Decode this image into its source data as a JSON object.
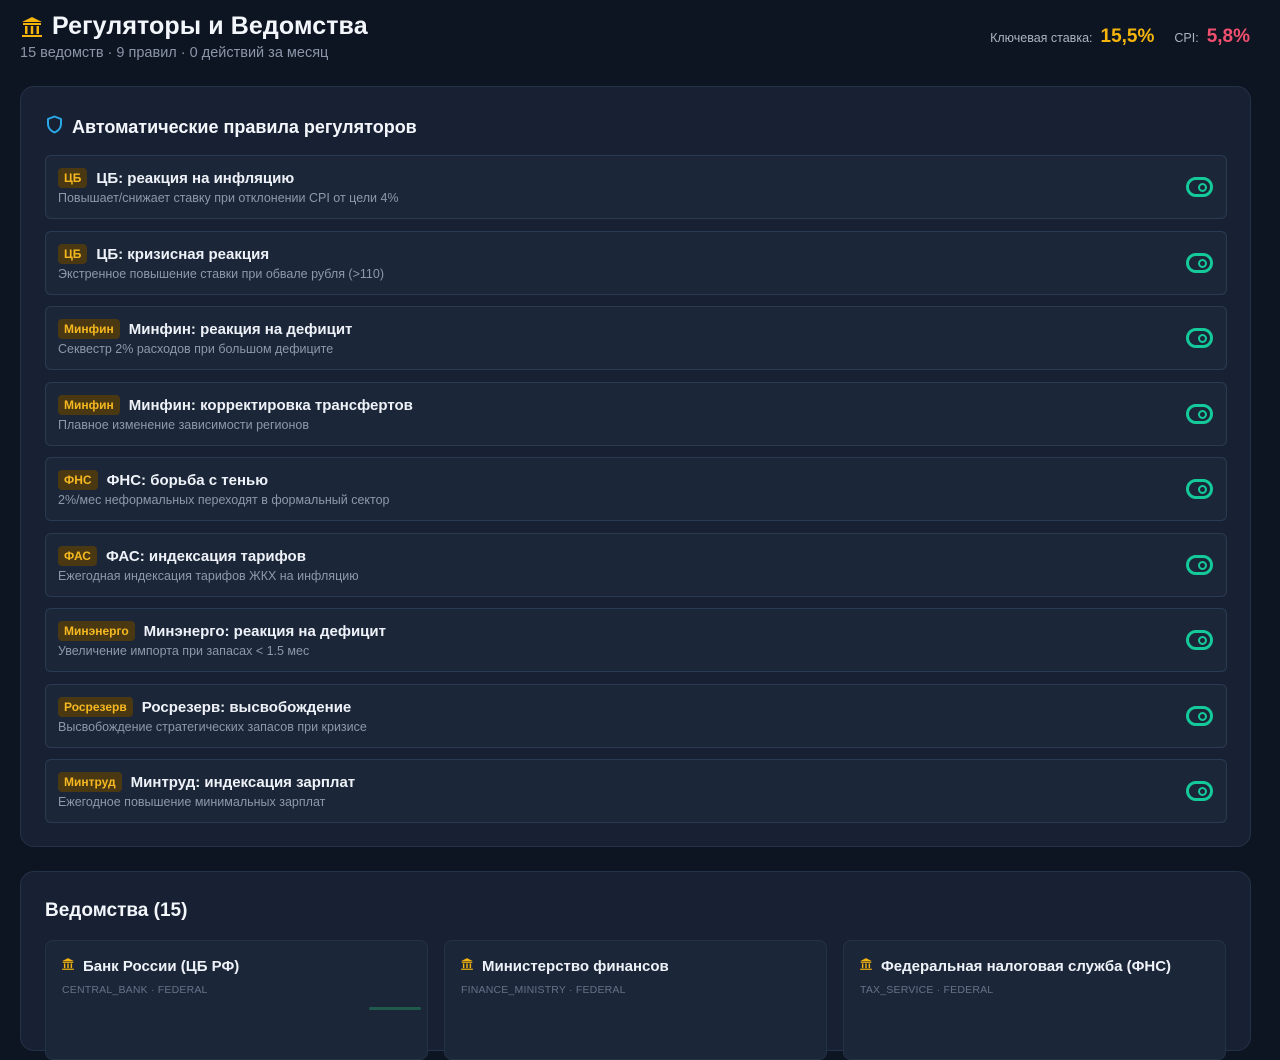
{
  "header": {
    "title": "Регуляторы и Ведомства",
    "subtitle": "15 ведомств · 9 правил · 0 действий за месяц",
    "key_rate_label": "Ключевая ставка:",
    "key_rate_value": "15,5%",
    "cpi_label": "CPI:",
    "cpi_value": "5,8%"
  },
  "rules_panel": {
    "title": "Автоматические правила регуляторов",
    "rules": [
      {
        "badge": "ЦБ",
        "name": "ЦБ: реакция на инфляцию",
        "desc": "Повышает/снижает ставку при отклонении CPI от цели 4%",
        "enabled": true
      },
      {
        "badge": "ЦБ",
        "name": "ЦБ: кризисная реакция",
        "desc": "Экстренное повышение ставки при обвале рубля (>110)",
        "enabled": true
      },
      {
        "badge": "Минфин",
        "name": "Минфин: реакция на дефицит",
        "desc": "Секвестр 2% расходов при большом дефиците",
        "enabled": true
      },
      {
        "badge": "Минфин",
        "name": "Минфин: корректировка трансфертов",
        "desc": "Плавное изменение зависимости регионов",
        "enabled": true
      },
      {
        "badge": "ФНС",
        "name": "ФНС: борьба с тенью",
        "desc": "2%/мес неформальных переходят в формальный сектор",
        "enabled": true
      },
      {
        "badge": "ФАС",
        "name": "ФАС: индексация тарифов",
        "desc": "Ежегодная индексация тарифов ЖКХ на инфляцию",
        "enabled": true
      },
      {
        "badge": "Минэнерго",
        "name": "Минэнерго: реакция на дефицит",
        "desc": "Увеличение импорта при запасах < 1.5 мес",
        "enabled": true
      },
      {
        "badge": "Росрезерв",
        "name": "Росрезерв: высвобождение",
        "desc": "Высвобождение стратегических запасов при кризисе",
        "enabled": true
      },
      {
        "badge": "Минтруд",
        "name": "Минтруд: индексация зарплат",
        "desc": "Ежегодное повышение минимальных зарплат",
        "enabled": true
      }
    ]
  },
  "agencies_panel": {
    "title": "Ведомства (15)",
    "agencies": [
      {
        "name": "Банк России (ЦБ РФ)",
        "code": "CENTRAL_BANK · FEDERAL"
      },
      {
        "name": "Министерство финансов",
        "code": "FINANCE_MINISTRY · FEDERAL"
      },
      {
        "name": "Федеральная налоговая служба (ФНС)",
        "code": "TAX_SERVICE · FEDERAL"
      }
    ]
  },
  "colors": {
    "accent_gold": "#f5b40c",
    "accent_red": "#f0506e",
    "toggle_on": "#14c99a",
    "shield": "#2aa7e6"
  },
  "icons": {
    "title": "bank-building-icon",
    "rules_panel": "shield-icon",
    "agency": "bank-building-icon",
    "rule_toggle": "toggle-on-icon"
  }
}
